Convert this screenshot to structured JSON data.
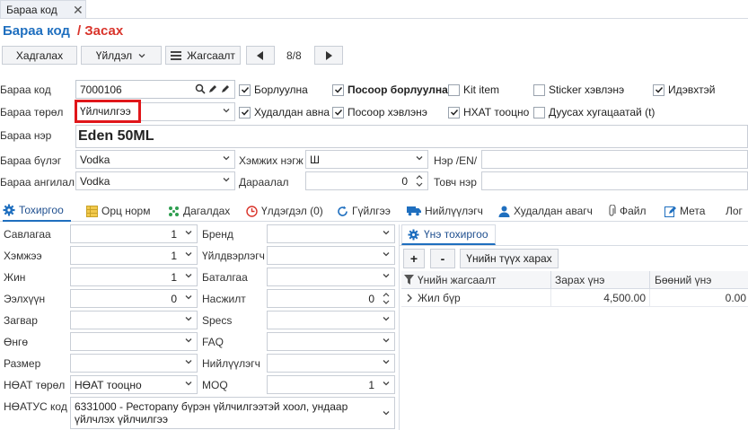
{
  "doc_tab": {
    "label": "Бараа код"
  },
  "title": {
    "main": "Бараа код",
    "sub": "/ Засах"
  },
  "toolbar": {
    "save": "Хадгалах",
    "action": "Үйлдэл",
    "list": "Жагсаалт",
    "counter": "8/8"
  },
  "fields": {
    "code_label": "Бараа код",
    "code_value": "7000106",
    "type_label": "Бараа төрөл",
    "type_value": "Үйлчилгээ",
    "name_label": "Бараа нэр",
    "name_value": "Eden 50ML",
    "group_label": "Бараа бүлэг",
    "group_value": "Vodka",
    "class_label": "Бараа ангилал",
    "class_value": "Vodka",
    "unit_label": "Хэмжих нэгж",
    "unit_value": "Ш",
    "order_label": "Дараалал",
    "order_value": "0",
    "name_en_label": "Нэр /EN/",
    "short_label": "Товч нэр"
  },
  "checks": {
    "sellable": {
      "label": "Борлуулна",
      "checked": true
    },
    "sell_by_qty": {
      "label": "Посоор борлуулна",
      "checked": true
    },
    "kit": {
      "label": "Kit item",
      "checked": false
    },
    "sticker": {
      "label": "Sticker хэвлэнэ",
      "checked": false
    },
    "active": {
      "label": "Идэвхтэй",
      "checked": true
    },
    "purchasable": {
      "label": "Худалдан авна",
      "checked": true
    },
    "pos_print": {
      "label": "Посоор хэвлэнэ",
      "checked": true
    },
    "vat": {
      "label": "НХАТ тооцно",
      "checked": true
    },
    "expiry": {
      "label": "Дуусах хугацаатай (t)",
      "checked": false
    }
  },
  "tabs": [
    {
      "label": "Тохиргоо",
      "icon": "gear-icon",
      "active": true
    },
    {
      "label": "Орц норм",
      "icon": "grid-icon"
    },
    {
      "label": "Дагалдах",
      "icon": "dots-icon"
    },
    {
      "label": "Үлдэгдэл (0)",
      "icon": "clock-icon"
    },
    {
      "label": "Гүйлгээ",
      "icon": "refresh-icon"
    },
    {
      "label": "Нийлүүлэгч",
      "icon": "truck-icon"
    },
    {
      "label": "Худалдан авагч",
      "icon": "person-icon"
    },
    {
      "label": "Файл",
      "icon": "paperclip-icon"
    },
    {
      "label": "Мета",
      "icon": "edit-icon"
    },
    {
      "label": "Лог"
    }
  ],
  "settings_left": [
    {
      "label": "Савлагаа",
      "value": "1"
    },
    {
      "label": "Хэмжээ",
      "value": "1"
    },
    {
      "label": "Жин",
      "value": "1"
    },
    {
      "label": "Ээлхүүн",
      "value": "0"
    },
    {
      "label": "Загвар",
      "value": ""
    },
    {
      "label": "Өнгө",
      "value": ""
    },
    {
      "label": "Размер",
      "value": ""
    }
  ],
  "settings_mid": [
    {
      "label": "Бренд",
      "value": ""
    },
    {
      "label": "Үйлдвэрлэгч",
      "value": ""
    },
    {
      "label": "Баталгаа",
      "value": ""
    },
    {
      "label": "Насжилт",
      "value": "0"
    },
    {
      "label": "Specs",
      "value": ""
    },
    {
      "label": "FAQ",
      "value": ""
    },
    {
      "label": "Нийлүүлэгч",
      "value": ""
    },
    {
      "label": "MOQ",
      "value": "1"
    }
  ],
  "vat_type": {
    "label": "НӨАТ төрөл",
    "value": "НӨАТ тооцно"
  },
  "vatus": {
    "label": "НӨАТУС код",
    "value": "6331000 - Ресторany бүрэн үйлчилгээтэй хоол, ундаар үйлчлэх үйлчилгээ"
  },
  "price": {
    "tab_label": "Үнэ тохиргоо",
    "add": "+",
    "remove": "-",
    "history": "Үнийн түүх харах",
    "headers": [
      "Үнийн жагсаалт",
      "Зарах үнэ",
      "Бөөний үнэ"
    ],
    "rows": [
      {
        "name": "Жил бүр",
        "sell": "4,500.00",
        "wholesale": "0.00"
      }
    ]
  },
  "accent_color": "#1f6fbf",
  "highlight_color": "#e0161a"
}
